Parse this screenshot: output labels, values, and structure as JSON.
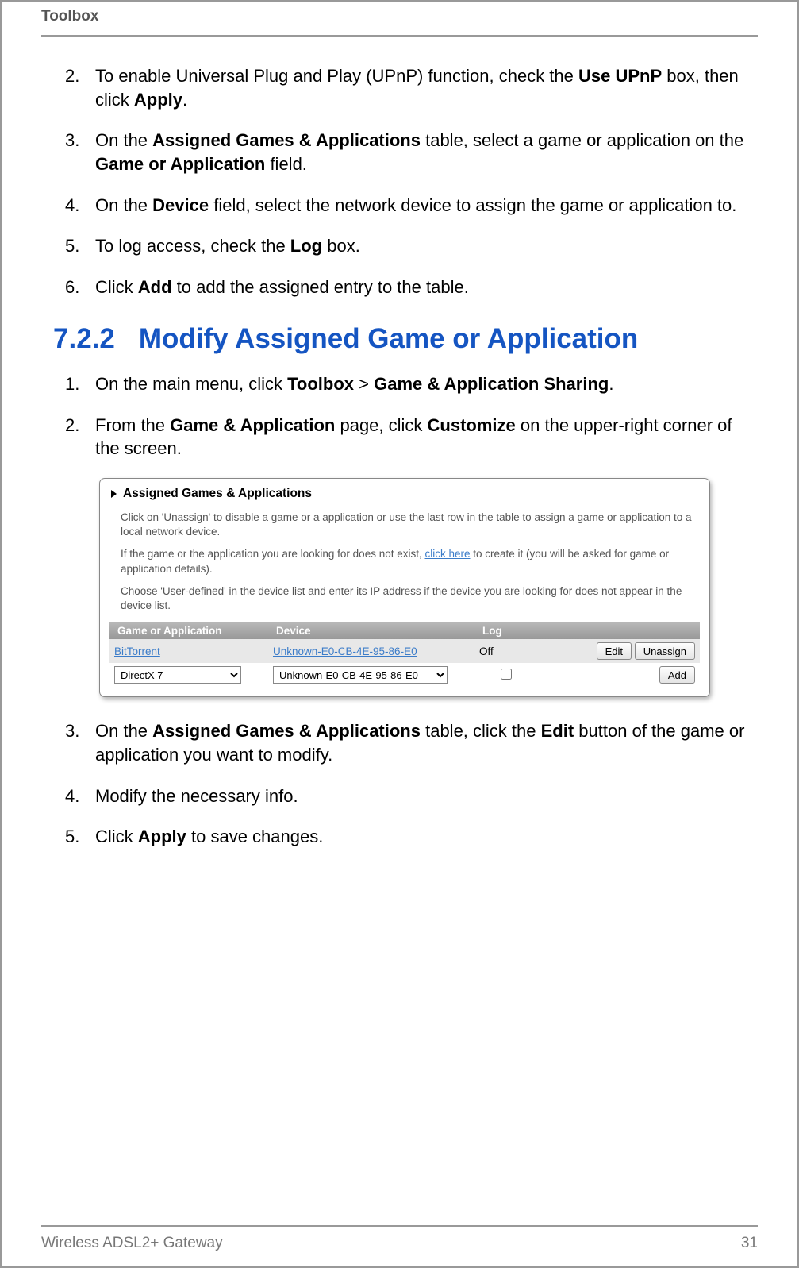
{
  "header": {
    "title": "Toolbox"
  },
  "listA": {
    "items": [
      {
        "num": "2.",
        "segments": [
          "To enable Universal Plug and Play (UPnP) function, check the ",
          {
            "b": "Use UPnP"
          },
          " box, then click ",
          {
            "b": "Apply"
          },
          "."
        ]
      },
      {
        "num": "3.",
        "segments": [
          "On the ",
          {
            "b": "Assigned Games & Applications"
          },
          " table, select a game or application on the ",
          {
            "b": "Game or Application"
          },
          " field."
        ]
      },
      {
        "num": "4.",
        "segments": [
          "On the ",
          {
            "b": "Device"
          },
          " field, select the network device to assign the game or application to."
        ]
      },
      {
        "num": "5.",
        "segments": [
          "To log access, check the ",
          {
            "b": "Log"
          },
          " box."
        ]
      },
      {
        "num": "6.",
        "segments": [
          "Click ",
          {
            "b": "Add"
          },
          " to add the assigned entry to the table."
        ]
      }
    ]
  },
  "section": {
    "number": "7.2.2",
    "title": "Modify Assigned Game or Application"
  },
  "listB": {
    "items": [
      {
        "num": "1.",
        "segments": [
          "On the main menu, click ",
          {
            "b": "Toolbox"
          },
          " > ",
          {
            "b": "Game & Application Sharing"
          },
          "."
        ]
      },
      {
        "num": "2.",
        "segments": [
          "From the ",
          {
            "b": "Game & Application"
          },
          " page, click ",
          {
            "b": "Customize"
          },
          " on the upper-right corner of the screen."
        ]
      }
    ]
  },
  "figure": {
    "title": "Assigned Games & Applications",
    "para1": "Click on 'Unassign' to disable a game or a application or use the last row in the table to assign a game or application to a local network device.",
    "para2_pre": "If the game or the application you are looking for does not exist, ",
    "para2_link": "click here",
    "para2_post": " to create it (you will be asked for game or application details).",
    "para3": "Choose 'User-defined' in the device list and enter its IP address if the device you are looking for does not appear in the device list.",
    "columns": {
      "c1": "Game or Application",
      "c2": "Device",
      "c3": "Log"
    },
    "row1": {
      "app": "BitTorrent",
      "device": "Unknown-E0-CB-4E-95-86-E0",
      "log": "Off",
      "btn_edit": "Edit",
      "btn_unassign": "Unassign"
    },
    "row2": {
      "app_selected": "DirectX 7",
      "device_selected": "Unknown-E0-CB-4E-95-86-E0",
      "btn_add": "Add"
    }
  },
  "listC": {
    "items": [
      {
        "num": "3.",
        "segments": [
          "On the ",
          {
            "b": "Assigned Games & Applications"
          },
          " table, click the ",
          {
            "b": "Edit"
          },
          " button of the game or application you want to modify."
        ]
      },
      {
        "num": "4.",
        "segments": [
          "Modify the necessary info."
        ]
      },
      {
        "num": "5.",
        "segments": [
          "Click ",
          {
            "b": "Apply"
          },
          " to save changes."
        ]
      }
    ]
  },
  "footer": {
    "left": "Wireless ADSL2+ Gateway",
    "right": "31"
  }
}
